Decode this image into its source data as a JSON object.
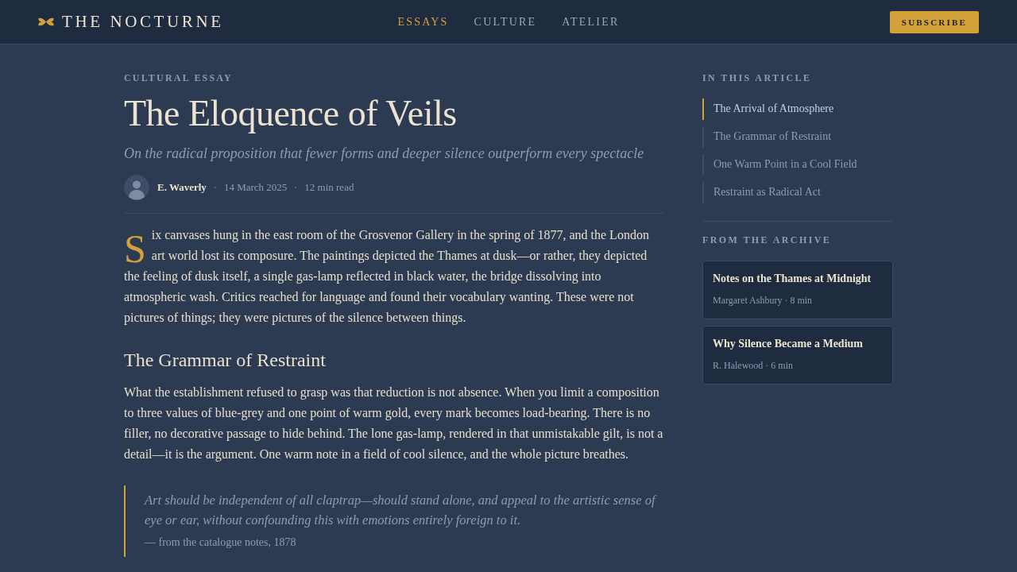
{
  "header": {
    "logo": "THE NOCTURNE",
    "nav": [
      {
        "label": "ESSAYS",
        "selected": true
      },
      {
        "label": "CULTURE",
        "selected": false
      },
      {
        "label": "ATELIER",
        "selected": false
      }
    ],
    "subscribe": "SUBSCRIBE"
  },
  "article": {
    "kicker": "CULTURAL ESSAY",
    "title": "The Eloquence of Veils",
    "subtitle": "On the radical proposition that fewer forms and deeper silence outperform every spectacle",
    "byline": {
      "author": "E. Waverly",
      "date": "14 March 2025",
      "read_time": "12 min read"
    },
    "body": [
      {
        "kind": "lead",
        "text": "Six canvases hung in the east room of the Grosvenor Gallery in the spring of 1877, and the London art world lost its composure. The paintings depicted the Thames at dusk—or rather, they depicted the feeling of dusk itself, a single gas-lamp reflected in black water, the bridge dissolving into atmospheric wash. Critics reached for language and found their vocabulary wanting. These were not pictures of things; they were pictures of the silence between things."
      },
      {
        "kind": "heading",
        "text": "The Grammar of Restraint"
      },
      {
        "kind": "paragraph",
        "text": "What the establishment refused to grasp was that reduction is not absence. When you limit a composition to three values of blue-grey and one point of warm gold, every mark becomes load-bearing. There is no filler, no decorative passage to hide behind. The lone gas-lamp, rendered in that unmistakable gilt, is not a detail—it is the argument. One warm note in a field of cool silence, and the whole picture breathes."
      },
      {
        "kind": "quote",
        "text": "Art should be independent of all claptrap—should stand alone, and appeal to the artistic sense of eye or ear, without confounding this with emotions entirely foreign to it.",
        "cite": "— from the catalogue notes, 1878"
      }
    ]
  },
  "sidebar": {
    "toc_title": "IN THIS ARTICLE",
    "toc": [
      {
        "label": "The Arrival of Atmosphere",
        "selected": true
      },
      {
        "label": "The Grammar of Restraint",
        "selected": false
      },
      {
        "label": "One Warm Point in a Cool Field",
        "selected": false
      },
      {
        "label": "Restraint as Radical Act",
        "selected": false
      }
    ],
    "archive_title": "FROM THE ARCHIVE",
    "archive": [
      {
        "title": "Notes on the Thames at Midnight",
        "meta": "Margaret Ashbury · 8 min"
      },
      {
        "title": "Why Silence Became a Medium",
        "meta": "R. Halewood · 6 min"
      }
    ]
  }
}
